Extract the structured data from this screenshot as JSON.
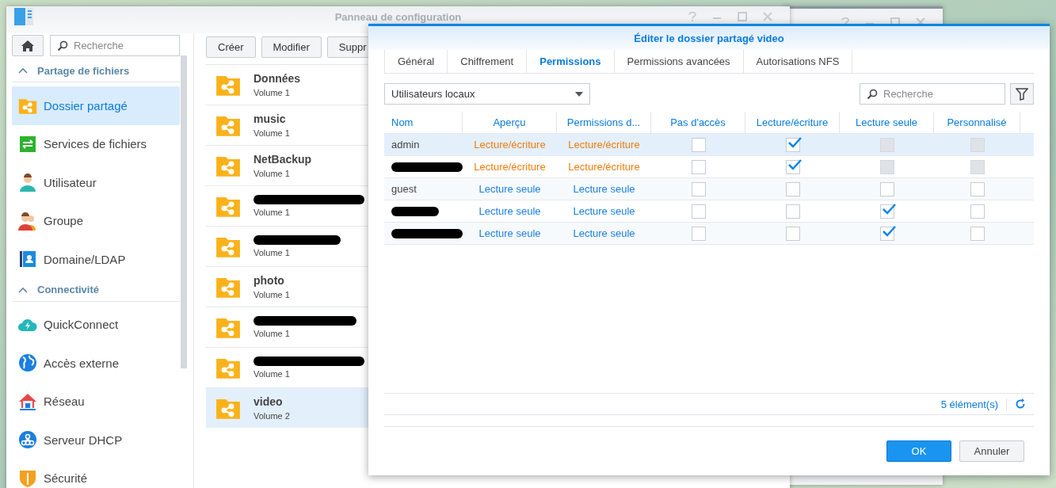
{
  "main_window": {
    "title": "Panneau de configuration",
    "search": {
      "placeholder": "Recherche"
    },
    "sidebar": [
      {
        "header": "Partage de fichiers",
        "items": [
          {
            "label": "Dossier partagé",
            "selected": true
          },
          {
            "label": "Services de fichiers",
            "selected": false
          },
          {
            "label": "Utilisateur",
            "selected": false
          },
          {
            "label": "Groupe",
            "selected": false
          },
          {
            "label": "Domaine/LDAP",
            "selected": false
          }
        ]
      },
      {
        "header": "Connectivité",
        "items": [
          {
            "label": "QuickConnect",
            "selected": false
          },
          {
            "label": "Accès externe",
            "selected": false
          },
          {
            "label": "Réseau",
            "selected": false
          },
          {
            "label": "Serveur DHCP",
            "selected": false
          },
          {
            "label": "Sécurité",
            "selected": false
          }
        ]
      }
    ],
    "toolbar": [
      "Créer",
      "Modifier",
      "Suppr"
    ],
    "folders": [
      {
        "name": "Données",
        "volume": "Volume 1",
        "selected": false
      },
      {
        "name": "music",
        "volume": "Volume 1",
        "selected": false
      },
      {
        "name": "NetBackup",
        "volume": "Volume 1",
        "selected": false
      },
      {
        "volume": "Volume 1",
        "selected": false
      },
      {
        "volume": "Volume 1",
        "selected": false
      },
      {
        "name": "photo",
        "volume": "Volume 1",
        "selected": false
      },
      {
        "volume": "Volume 1",
        "selected": false
      },
      {
        "volume": "Volume 1",
        "selected": false
      },
      {
        "name": "video",
        "volume": "Volume 2",
        "selected": true
      }
    ]
  },
  "dialog": {
    "title": "Éditer le dossier partagé video",
    "tabs": [
      {
        "label": "Général",
        "selected": false
      },
      {
        "label": "Chiffrement",
        "selected": false
      },
      {
        "label": "Permissions",
        "selected": true
      },
      {
        "label": "Permissions avancées",
        "selected": false
      },
      {
        "label": "Autorisations NFS",
        "selected": false
      }
    ],
    "user_filter": "Utilisateurs locaux",
    "search": {
      "placeholder": "Recherche"
    },
    "columns": [
      "Nom",
      "Aperçu",
      "Permissions d...",
      "Pas d'accès",
      "Lecture/écriture",
      "Lecture seule",
      "Personnalisé"
    ],
    "rows": [
      {
        "name": "admin",
        "color": "#f07c10",
        "preview": "Lecture/écriture",
        "permission": "Lecture/écriture",
        "selected": true,
        "checks": [
          {
            "checked": false,
            "disabled": false
          },
          {
            "checked": true,
            "disabled": false
          },
          {
            "checked": false,
            "disabled": true
          },
          {
            "checked": false,
            "disabled": true
          }
        ]
      },
      {
        "color": "#f07c10",
        "preview": "Lecture/écriture",
        "permission": "Lecture/écriture",
        "selected": false,
        "checks": [
          {
            "checked": false,
            "disabled": false
          },
          {
            "checked": true,
            "disabled": false
          },
          {
            "checked": false,
            "disabled": true
          },
          {
            "checked": false,
            "disabled": true
          }
        ]
      },
      {
        "name": "guest",
        "color": "#1a7fe0",
        "preview": "Lecture seule",
        "permission": "Lecture seule",
        "selected": false,
        "checks": [
          {
            "checked": false,
            "disabled": false
          },
          {
            "checked": false,
            "disabled": false
          },
          {
            "checked": false,
            "disabled": false
          },
          {
            "checked": false,
            "disabled": false
          }
        ]
      },
      {
        "color": "#1a7fe0",
        "preview": "Lecture seule",
        "permission": "Lecture seule",
        "selected": false,
        "checks": [
          {
            "checked": false,
            "disabled": false
          },
          {
            "checked": false,
            "disabled": false
          },
          {
            "checked": true,
            "disabled": false
          },
          {
            "checked": false,
            "disabled": false
          }
        ]
      },
      {
        "color": "#1a7fe0",
        "preview": "Lecture seule",
        "permission": "Lecture seule",
        "selected": false,
        "checks": [
          {
            "checked": false,
            "disabled": false
          },
          {
            "checked": false,
            "disabled": false
          },
          {
            "checked": true,
            "disabled": false
          },
          {
            "checked": false,
            "disabled": false
          }
        ]
      }
    ],
    "count": "5 élément(s)",
    "buttons": [
      {
        "label": "OK",
        "kind": "primary"
      },
      {
        "label": "Annuler",
        "kind": "secondary"
      }
    ]
  }
}
